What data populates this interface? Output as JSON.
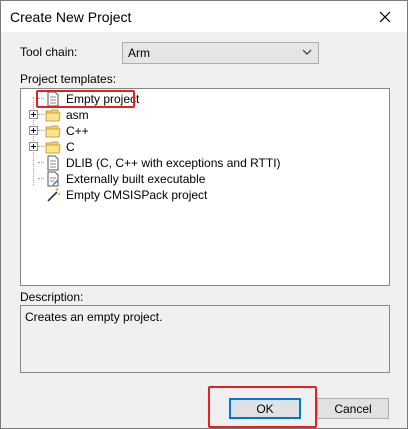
{
  "window": {
    "title": "Create New Project"
  },
  "toolchain": {
    "label": "Tool chain:",
    "value": "Arm"
  },
  "templates": {
    "label": "Project templates:",
    "items": [
      {
        "label": "Empty project",
        "icon": "document-icon",
        "expandable": false
      },
      {
        "label": "asm",
        "icon": "folder-icon",
        "expandable": true
      },
      {
        "label": "C++",
        "icon": "folder-icon",
        "expandable": true
      },
      {
        "label": "C",
        "icon": "folder-icon",
        "expandable": true
      },
      {
        "label": "DLIB (C, C++ with exceptions and RTTI)",
        "icon": "document-icon",
        "expandable": false
      },
      {
        "label": "Externally built executable",
        "icon": "document-edit-icon",
        "expandable": false
      },
      {
        "label": "Empty CMSISPack project",
        "icon": "wand-icon",
        "expandable": false
      }
    ]
  },
  "description": {
    "label": "Description:",
    "text": "Creates an empty project."
  },
  "buttons": {
    "ok": "OK",
    "cancel": "Cancel"
  },
  "colors": {
    "highlight": "#e62020",
    "ok_border": "#0078d7"
  }
}
